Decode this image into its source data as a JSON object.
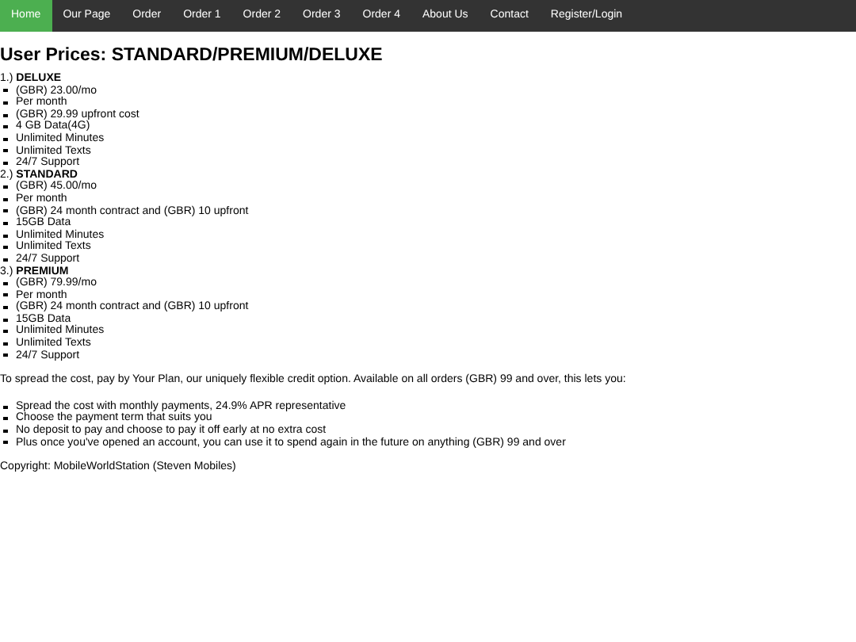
{
  "nav": [
    {
      "label": "Home",
      "selected": true
    },
    {
      "label": "Our Page",
      "selected": false
    },
    {
      "label": "Order",
      "selected": false
    },
    {
      "label": "Order 1",
      "selected": false
    },
    {
      "label": "Order 2",
      "selected": false
    },
    {
      "label": "Order 3",
      "selected": false
    },
    {
      "label": "Order 4",
      "selected": false
    },
    {
      "label": "About Us",
      "selected": false
    },
    {
      "label": "Contact",
      "selected": false
    },
    {
      "label": "Register/Login",
      "selected": false
    }
  ],
  "title": "User Prices: STANDARD/PREMIUM/DELUXE",
  "plans": [
    {
      "number": "1.)",
      "name": "DELUXE",
      "features": [
        "(GBR) 23.00/mo",
        "Per month",
        "(GBR) 29.99 upfront cost",
        "4 GB Data(4G)",
        "Unlimited Minutes",
        "Unlimited Texts",
        "24/7 Support"
      ]
    },
    {
      "number": "2.)",
      "name": "STANDARD",
      "features": [
        "(GBR) 45.00/mo",
        "Per month",
        "(GBR) 24 month contract and (GBR) 10 upfront",
        "15GB Data",
        "Unlimited Minutes",
        "Unlimited Texts",
        "24/7 Support"
      ]
    },
    {
      "number": "3.)",
      "name": "PREMIUM",
      "features": [
        "(GBR) 79.99/mo",
        "Per month",
        "(GBR) 24 month contract and (GBR) 10 upfront",
        "15GB Data",
        "Unlimited Minutes",
        "Unlimited Texts",
        "24/7 Support"
      ]
    }
  ],
  "intro": "To spread the cost, pay by Your Plan, our uniquely flexible credit option. Available on all orders (GBR) 99 and over, this lets you:",
  "benefits": [
    "Spread the cost with monthly payments, 24.9% APR representative",
    "Choose the payment term that suits you",
    "No deposit to pay and choose to pay it off early at no extra cost",
    "Plus once you've opened an account, you can use it to spend again in the future on anything (GBR) 99 and over"
  ],
  "footer": "Copyright: MobileWorldStation (Steven Mobiles)"
}
